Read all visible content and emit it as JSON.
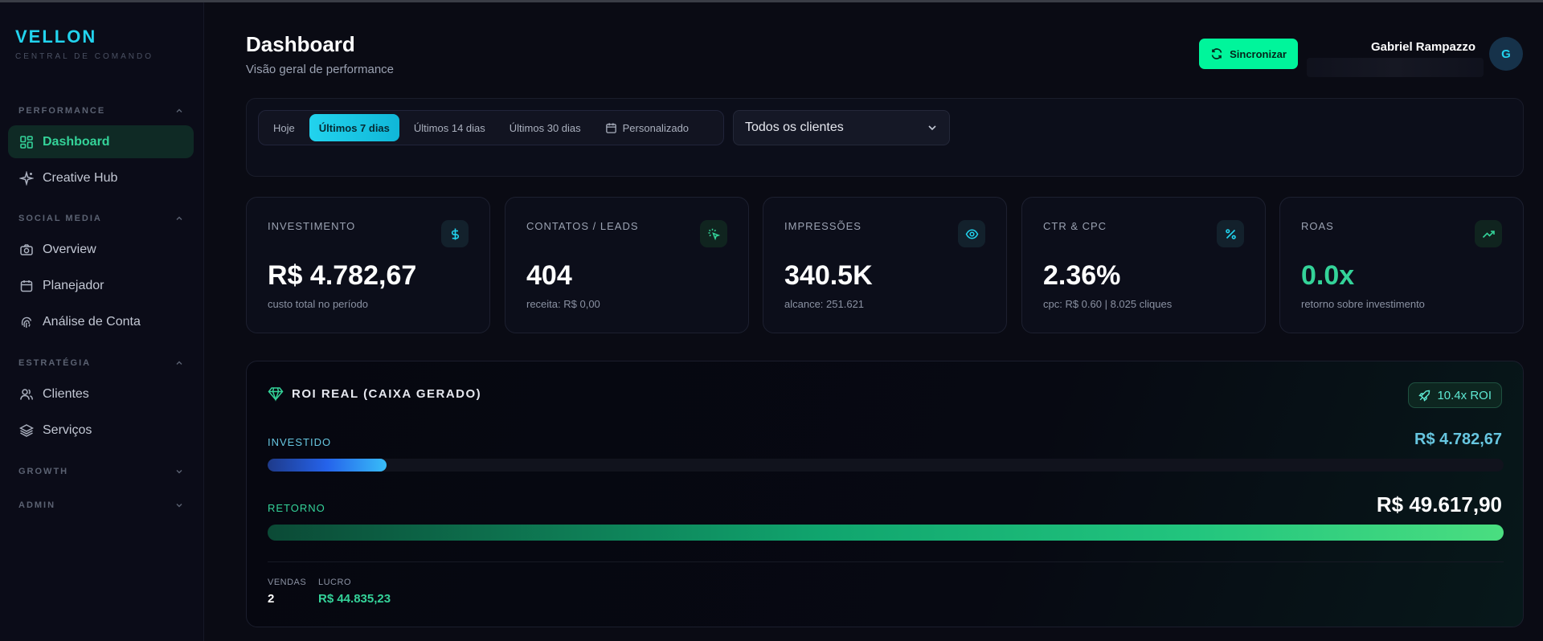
{
  "brand": {
    "name": "VELLON",
    "subtitle": "CENTRAL DE COMANDO"
  },
  "sidebar": {
    "sections": [
      {
        "label": "PERFORMANCE",
        "expanded": true
      },
      {
        "label": "SOCIAL MEDIA",
        "expanded": true
      },
      {
        "label": "ESTRATÉGIA",
        "expanded": true
      },
      {
        "label": "GROWTH",
        "expanded": false
      },
      {
        "label": "ADMIN",
        "expanded": false
      }
    ],
    "items": [
      {
        "label": "Dashboard",
        "icon": "grid-icon",
        "active": true
      },
      {
        "label": "Creative Hub",
        "icon": "sparkles-icon"
      },
      {
        "label": "Overview",
        "icon": "camera-icon"
      },
      {
        "label": "Planejador",
        "icon": "calendar-icon"
      },
      {
        "label": "Análise de Conta",
        "icon": "fingerprint-icon"
      },
      {
        "label": "Clientes",
        "icon": "users-icon"
      },
      {
        "label": "Serviços",
        "icon": "layers-icon"
      }
    ]
  },
  "header": {
    "title": "Dashboard",
    "subtitle": "Visão geral de performance",
    "sync_label": "Sincronizar",
    "user_name": "Gabriel Rampazzo",
    "avatar_initial": "G"
  },
  "filters": {
    "ranges": [
      "Hoje",
      "Últimos 7 dias",
      "Últimos 14 dias",
      "Últimos 30 dias",
      "Personalizado"
    ],
    "active_range": "Últimos 7 dias",
    "client_select": "Todos os clientes"
  },
  "kpis": [
    {
      "label": "INVESTIMENTO",
      "value": "R$ 4.782,67",
      "sub": "custo total no período",
      "icon": "dollar-icon"
    },
    {
      "label": "CONTATOS / LEADS",
      "value": "404",
      "sub": "receita: R$ 0,00",
      "icon": "pointer-click-icon"
    },
    {
      "label": "IMPRESSÕES",
      "value": "340.5K",
      "sub": "alcance: 251.621",
      "icon": "eye-icon"
    },
    {
      "label": "CTR & CPC",
      "value": "2.36%",
      "sub": "cpc: R$ 0.60 | 8.025 cliques",
      "icon": "percent-icon"
    },
    {
      "label": "ROAS",
      "value": "0.0x",
      "sub": "retorno sobre investimento",
      "icon": "trending-up-icon"
    }
  ],
  "roi": {
    "title": "ROI REAL (CAIXA GERADO)",
    "badge": "10.4x ROI",
    "invested_label": "INVESTIDO",
    "invested_value": "R$ 4.782,67",
    "invested_fraction": 0.0964,
    "return_label": "RETORNO",
    "return_value": "R$ 49.617,90",
    "return_fraction": 1.0,
    "sales_label": "VENDAS",
    "sales_value": "2",
    "profit_label": "LUCRO",
    "profit_value": "R$ 44.835,23"
  },
  "colors": {
    "accent_cyan": "#22d3ee",
    "accent_green": "#00f59b",
    "positive": "#34d399"
  }
}
